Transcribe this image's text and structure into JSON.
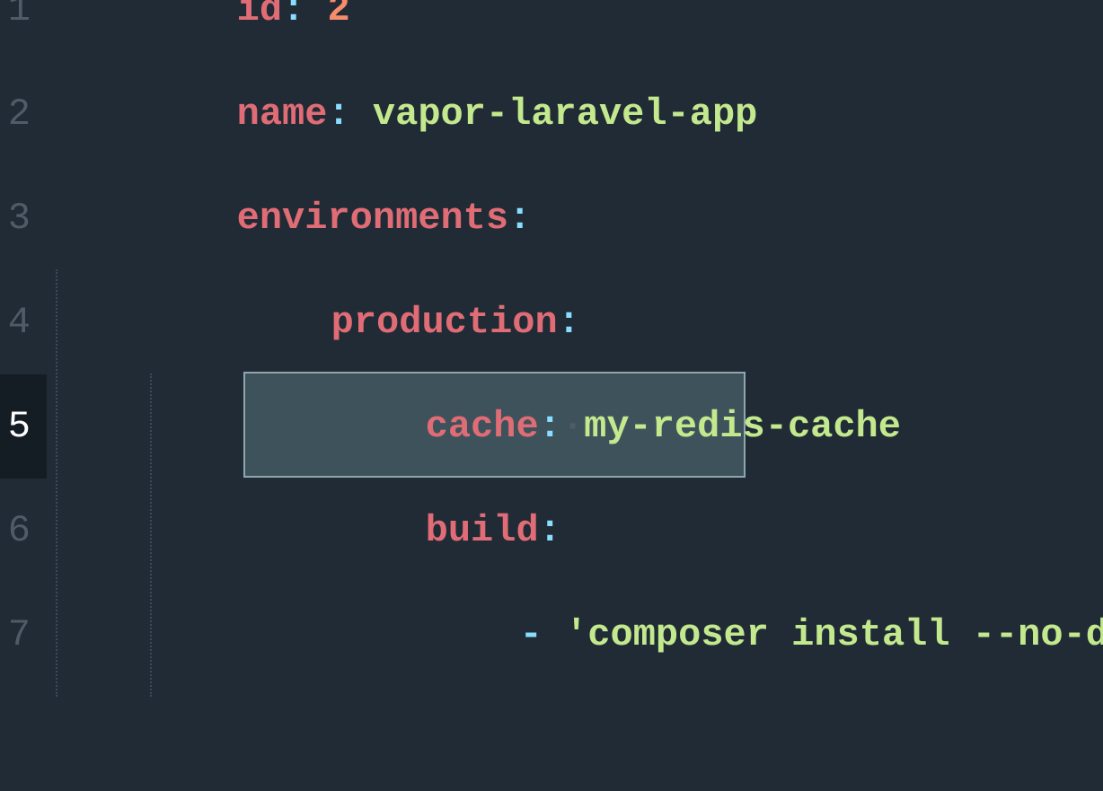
{
  "lines": {
    "1": {
      "number": "1",
      "key": "id",
      "colon": ":",
      "value": "2"
    },
    "2": {
      "number": "2",
      "key": "name",
      "colon": ":",
      "value": "vapor-laravel-app"
    },
    "3": {
      "number": "3",
      "key": "environments",
      "colon": ":"
    },
    "4": {
      "number": "4",
      "key": "production",
      "colon": ":"
    },
    "5": {
      "number": "5",
      "key": "cache",
      "colon": ":",
      "dot": "·",
      "value": "my-redis-cache"
    },
    "6": {
      "number": "6",
      "key": "build",
      "colon": ":"
    },
    "7": {
      "number": "7",
      "dash": "-",
      "quote_open": "'",
      "value": "composer install --no-dev",
      "quote_close": "'"
    }
  }
}
